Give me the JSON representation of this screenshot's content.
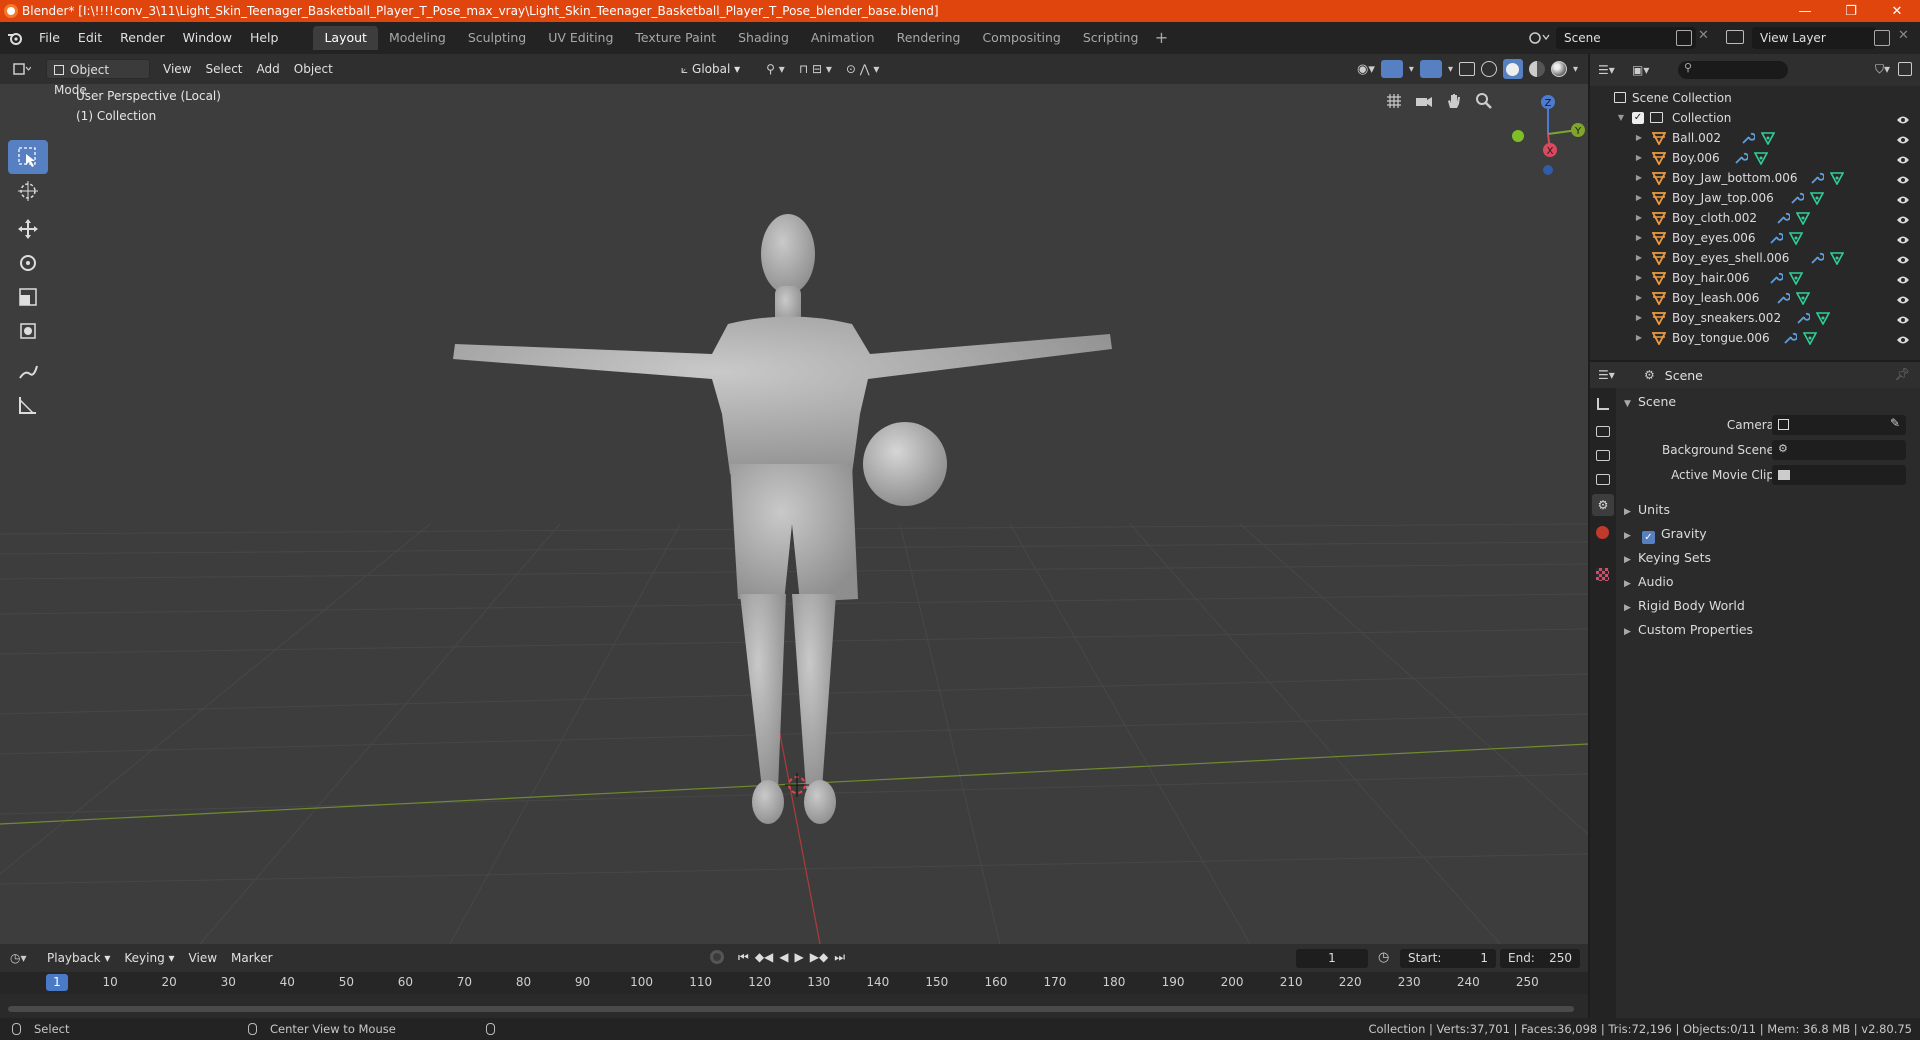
{
  "window": {
    "title": "Blender* [I:\\!!!!conv_3\\11\\Light_Skin_Teenager_Basketball_Player_T_Pose_max_vray\\Light_Skin_Teenager_Basketball_Player_T_Pose_blender_base.blend]",
    "controls": [
      "—",
      "❐",
      "✕"
    ]
  },
  "menu": [
    "File",
    "Edit",
    "Render",
    "Window",
    "Help"
  ],
  "workspaces": [
    "Layout",
    "Modeling",
    "Sculpting",
    "UV Editing",
    "Texture Paint",
    "Shading",
    "Animation",
    "Rendering",
    "Compositing",
    "Scripting"
  ],
  "active_workspace": "Layout",
  "scene_selector": "Scene",
  "view_layer": "View Layer",
  "viewport": {
    "mode": "Object Mode",
    "menus": [
      "View",
      "Select",
      "Add",
      "Object"
    ],
    "orientation": "Global",
    "info_line1": "User Perspective (Local)",
    "info_line2": "(1) Collection",
    "gizmo_axes": {
      "z": "Z",
      "y": "Y",
      "x": "X"
    }
  },
  "outliner": {
    "root": "Scene Collection",
    "collection": "Collection",
    "objects": [
      "Ball.002",
      "Boy.006",
      "Boy_Jaw_bottom.006",
      "Boy_Jaw_top.006",
      "Boy_cloth.002",
      "Boy_eyes.006",
      "Boy_eyes_shell.006",
      "Boy_hair.006",
      "Boy_leash.006",
      "Boy_sneakers.002",
      "Boy_tongue.006"
    ]
  },
  "properties": {
    "header": "Scene",
    "panel": "Scene",
    "camera_label": "Camera",
    "background_scene_label": "Background Scene",
    "active_movie_clip_label": "Active Movie Clip",
    "sections": [
      "Units",
      "Gravity",
      "Keying Sets",
      "Audio",
      "Rigid Body World",
      "Custom Properties"
    ],
    "gravity_checked": true
  },
  "timeline": {
    "menus": [
      "Playback",
      "Keying",
      "View",
      "Marker"
    ],
    "current_frame": "1",
    "start_label": "Start:",
    "start": "1",
    "end_label": "End:",
    "end": "250",
    "ruler": [
      "10",
      "20",
      "30",
      "40",
      "50",
      "60",
      "70",
      "80",
      "90",
      "100",
      "110",
      "120",
      "130",
      "140",
      "150",
      "160",
      "170",
      "180",
      "190",
      "200",
      "210",
      "220",
      "230",
      "240",
      "250"
    ],
    "ruler_current": "1"
  },
  "status": {
    "left": "Select",
    "middle": "Center View to Mouse",
    "right": "Collection | Verts:37,701 | Faces:36,098 | Tris:72,196 | Objects:0/11 | Mem: 36.8 MB | v2.80.75"
  }
}
